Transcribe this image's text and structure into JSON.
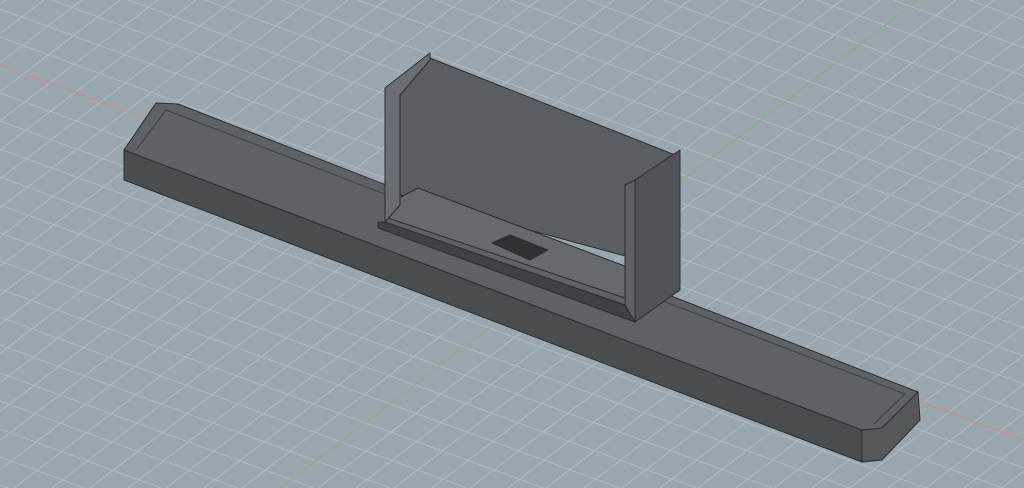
{
  "viewport": {
    "background_color": "#9ba7af",
    "grid_color": "#b4bec4",
    "x_axis_color": "#c98a8a",
    "y_axis_color": "#7fb07f",
    "model_color": "#5b5f63"
  }
}
